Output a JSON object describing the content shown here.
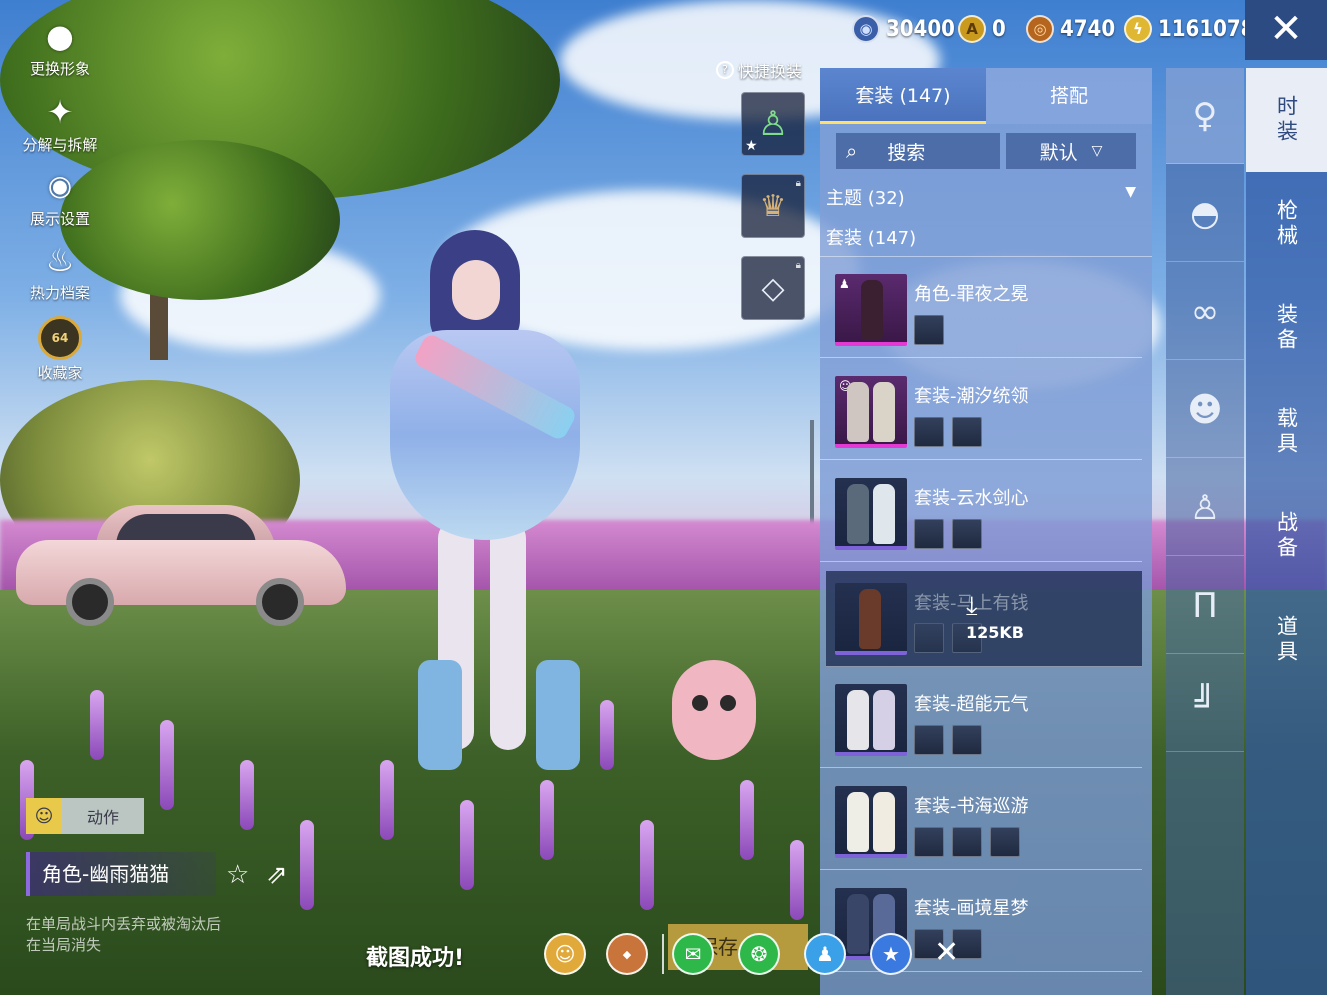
{
  "currency": [
    {
      "icon": "blue-coin-icon",
      "value": "30400",
      "color": "#3a5fa8"
    },
    {
      "icon": "gold-a-coin-icon",
      "value": "0",
      "color": "#c99a1e"
    },
    {
      "icon": "bronze-coin-icon",
      "value": "4740",
      "color": "#b5651d"
    },
    {
      "icon": "lightning-coin-icon",
      "value": "1161078",
      "color": "#e0b732"
    }
  ],
  "left_menu": [
    {
      "icon": "avatar-icon",
      "label": "更换形象"
    },
    {
      "icon": "puzzle-icon",
      "label": "分解与拆解"
    },
    {
      "icon": "eye-icon",
      "label": "展示设置"
    },
    {
      "icon": "flame-icon",
      "label": "热力档案"
    },
    {
      "icon": "collector-badge-icon",
      "label": "收藏家",
      "badge": "64"
    }
  ],
  "quick_change": {
    "label": "快捷换装",
    "help": "?"
  },
  "panel": {
    "tabs": [
      {
        "label": "套装 (147)",
        "active": true
      },
      {
        "label": "搭配",
        "active": false
      }
    ],
    "search_label": "搜索",
    "sort_label": "默认",
    "theme_header": "主题 (32)",
    "suits_header": "套装 (147)",
    "items": [
      {
        "title": "角色-罪夜之冕",
        "rarity": "pink",
        "subthumbs": 1
      },
      {
        "title": "套装-潮汐统领",
        "rarity": "pink",
        "subthumbs": 2
      },
      {
        "title": "套装-云水剑心",
        "rarity": "blue",
        "subthumbs": 2
      },
      {
        "title": "套装-马上有钱",
        "rarity": "blue",
        "subthumbs": 2,
        "selected": true,
        "download_size": "125KB"
      },
      {
        "title": "套装-超能元气",
        "rarity": "blue",
        "subthumbs": 2
      },
      {
        "title": "套装-书海巡游",
        "rarity": "blue",
        "subthumbs": 3
      },
      {
        "title": "套装-画境星梦",
        "rarity": "blue",
        "subthumbs": 2
      }
    ]
  },
  "category_icons": [
    {
      "icon": "character-icon",
      "active": true
    },
    {
      "icon": "cap-icon",
      "active": false
    },
    {
      "icon": "glasses-icon",
      "active": false
    },
    {
      "icon": "mask-icon",
      "active": false
    },
    {
      "icon": "outfit-figure-icon",
      "active": false
    },
    {
      "icon": "pants-icon",
      "active": false
    },
    {
      "icon": "boots-icon",
      "active": false
    }
  ],
  "main_categories": [
    {
      "label": "时装",
      "active": true
    },
    {
      "label": "枪械",
      "active": false
    },
    {
      "label": "装备",
      "active": false
    },
    {
      "label": "载具",
      "active": false
    },
    {
      "label": "战备",
      "active": false
    },
    {
      "label": "道具",
      "active": false
    }
  ],
  "role": {
    "action_label": "动作",
    "name": "角色-幽雨猫猫",
    "note_line1": "在单局战斗内丢弃或被淘汰后",
    "note_line2": "在当局消失"
  },
  "screenshot_bar": {
    "success_text": "截图成功!",
    "save_label": "保存",
    "share_icons": [
      "avatar-share-icon",
      "peace-elite-icon",
      "wechat-icon",
      "moments-icon",
      "qq-icon",
      "qzone-icon"
    ]
  }
}
